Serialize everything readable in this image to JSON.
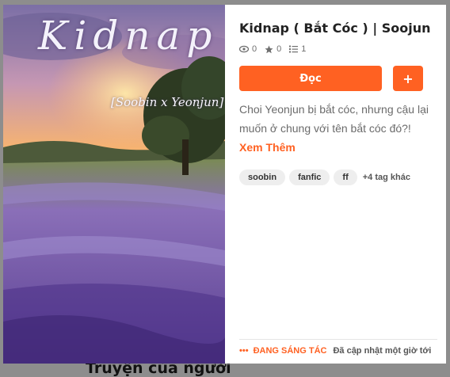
{
  "background": {
    "partial_text": "Truyện của người"
  },
  "cover": {
    "title": "Kidnap",
    "subtitle": "[Soobin x Yeonjun]"
  },
  "story": {
    "title": "Kidnap ( Bắt Cóc ) | Soojun",
    "views": "0",
    "votes": "0",
    "parts": "1",
    "description": "Choi Yeonjun bị bắt cóc, nhưng cậu lại muốn ở chung với tên bắt cóc đó?!",
    "read_more": "Xem Thêm"
  },
  "actions": {
    "read_label": "Đọc",
    "add_label": "+"
  },
  "tags": [
    "soobin",
    "fanfic",
    "ff"
  ],
  "more_tags": "+4 tag khác",
  "footer": {
    "status_icon": "•••",
    "status": "ĐANG SÁNG TÁC",
    "updated": "Đã cập nhật một giờ tới"
  },
  "colors": {
    "accent": "#ff6122"
  }
}
